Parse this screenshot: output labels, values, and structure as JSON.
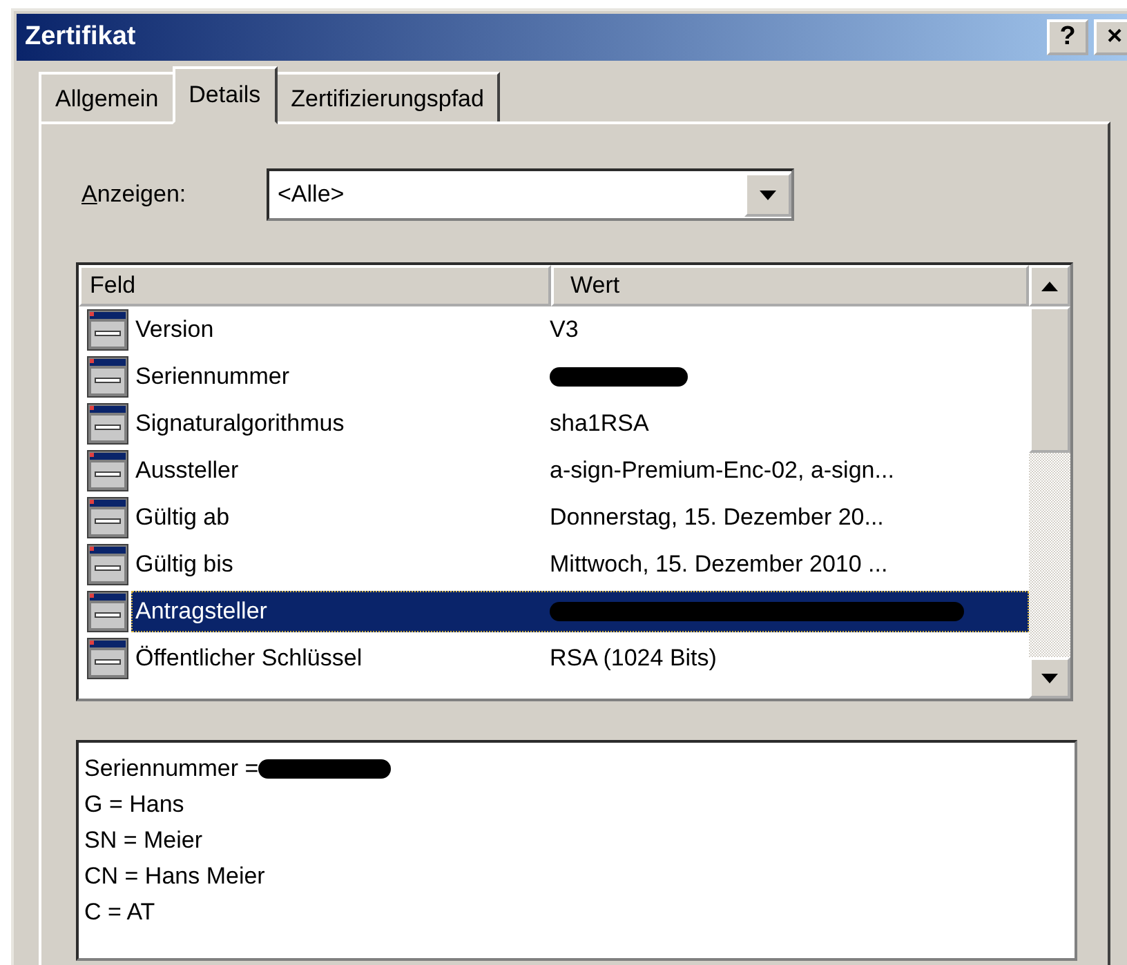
{
  "window": {
    "title": "Zertifikat",
    "title_buttons": [
      "?",
      "×"
    ]
  },
  "tabs": [
    {
      "label": "Allgemein",
      "selected": false
    },
    {
      "label": "Details",
      "selected": true
    },
    {
      "label": "Zertifizierungspfad",
      "selected": false
    }
  ],
  "show": {
    "label": "Anzeigen:",
    "value": "<Alle>"
  },
  "table": {
    "columns": [
      "Feld",
      "Wert"
    ],
    "rows": [
      {
        "field": "Version",
        "value": "V3",
        "redacted": false,
        "selected": false
      },
      {
        "field": "Seriennummer",
        "redacted": true,
        "selected": false
      },
      {
        "field": "Signaturalgorithmus",
        "value": "sha1RSA",
        "redacted": false,
        "selected": false
      },
      {
        "field": "Aussteller",
        "value": "a-sign-Premium-Enc-02, a-sign...",
        "redacted": false,
        "selected": false
      },
      {
        "field": "Gültig ab",
        "value": "Donnerstag, 15. Dezember 20...",
        "redacted": false,
        "selected": false
      },
      {
        "field": "Gültig bis",
        "value": "Mittwoch, 15. Dezember 2010 ...",
        "redacted": false,
        "selected": false
      },
      {
        "field": "Antragsteller",
        "redacted": true,
        "selected": true
      },
      {
        "field": "Öffentlicher Schlüssel",
        "value": "RSA (1024 Bits)",
        "redacted": false,
        "selected": false
      }
    ]
  },
  "details": [
    {
      "text": "Seriennummer =",
      "redacted": true
    },
    {
      "text": "G = Hans",
      "redacted": false
    },
    {
      "text": "SN = Meier",
      "redacted": false
    },
    {
      "text": "CN = Hans Meier",
      "redacted": false
    },
    {
      "text": "C = AT",
      "redacted": false
    }
  ]
}
